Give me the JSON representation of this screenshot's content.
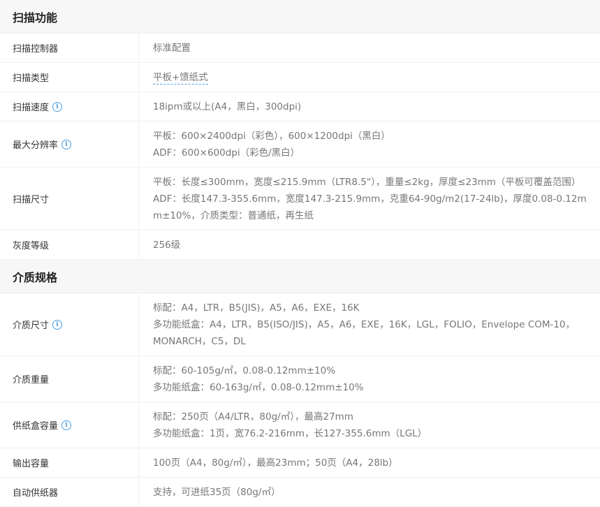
{
  "sections": [
    {
      "title": "扫描功能",
      "rows": [
        {
          "label": "扫描控制器",
          "info": false,
          "lines": [
            "标准配置"
          ]
        },
        {
          "label": "扫描类型",
          "info": false,
          "dashed": true,
          "lines": [
            "平板+馈纸式"
          ]
        },
        {
          "label": "扫描速度",
          "info": true,
          "lines": [
            "18ipm或以上(A4，黑白，300dpi)"
          ]
        },
        {
          "label": "最大分辨率",
          "info": true,
          "lines": [
            "平板：600×2400dpi（彩色），600×1200dpi（黑白）",
            "ADF：600×600dpi（彩色/黑白）"
          ]
        },
        {
          "label": "扫描尺寸",
          "info": false,
          "lines": [
            "平板：长度≤300mm，宽度≤215.9mm（LTR8.5\"），重量≤2kg，厚度≤23mm（平板可覆盖范围）",
            "ADF：长度147.3-355.6mm，宽度147.3-215.9mm，克重64-90g/m2(17-24lb)，厚度0.08-0.12m",
            "m±10%，介质类型：普通纸，再生纸"
          ]
        },
        {
          "label": "灰度等级",
          "info": false,
          "lines": [
            "256级"
          ]
        }
      ]
    },
    {
      "title": "介质规格",
      "rows": [
        {
          "label": "介质尺寸",
          "info": true,
          "lines": [
            "标配：A4，LTR，B5(JIS)，A5，A6，EXE，16K",
            "多功能纸盒：A4，LTR，B5(ISO/JIS)，A5，A6，EXE，16K，LGL，FOLIO，Envelope COM-10，",
            "MONARCH，C5，DL"
          ]
        },
        {
          "label": "介质重量",
          "info": false,
          "lines": [
            "标配：60-105g/㎡，0.08-0.12mm±10%",
            "多功能纸盒：60-163g/㎡，0.08-0.12mm±10%"
          ]
        },
        {
          "label": "供纸盒容量",
          "info": true,
          "lines": [
            "标配：250页（A4/LTR，80g/㎡），最高27mm",
            "多功能纸盒：1页，宽76.2-216mm，长127-355.6mm（LGL）"
          ]
        },
        {
          "label": "输出容量",
          "info": false,
          "lines": [
            "100页（A4，80g/㎡），最高23mm；50页（A4，28lb）"
          ]
        },
        {
          "label": "自动供纸器",
          "info": false,
          "lines": [
            "支持，可进纸35页（80g/㎡）"
          ]
        }
      ]
    }
  ],
  "icons": {
    "info": "info-icon"
  }
}
